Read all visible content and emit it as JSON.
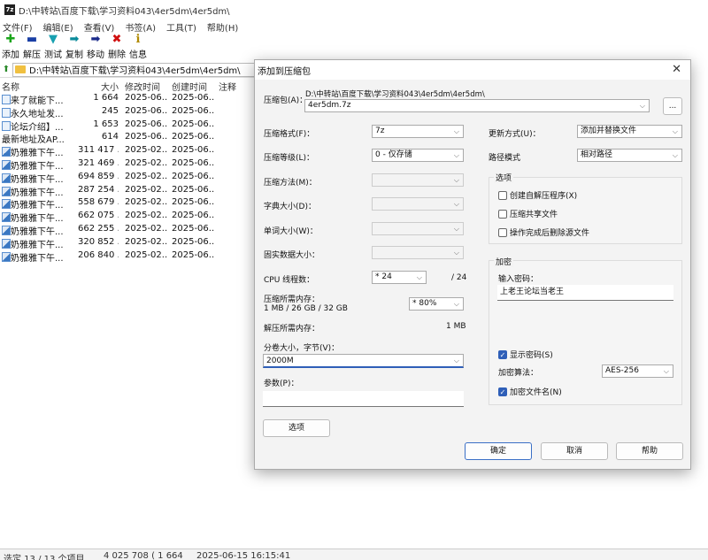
{
  "window": {
    "title": "D:\\中转站\\百度下载\\学习资料043\\4er5dm\\4er5dm\\",
    "icon": "7z"
  },
  "menu": [
    "文件(F)",
    "编辑(E)",
    "查看(V)",
    "书签(A)",
    "工具(T)",
    "帮助(H)"
  ],
  "toolbar": [
    {
      "label": "添加",
      "icon": "plus-icon",
      "glyph": "✚",
      "color": "#1aa51a"
    },
    {
      "label": "解压",
      "icon": "minus-icon",
      "glyph": "▬",
      "color": "#1a3fa5"
    },
    {
      "label": "测试",
      "icon": "check-icon",
      "glyph": "▼",
      "color": "#18a0b0"
    },
    {
      "label": "复制",
      "icon": "copy-arrow-icon",
      "glyph": "➡",
      "color": "#0a8a9a"
    },
    {
      "label": "移动",
      "icon": "move-arrow-icon",
      "glyph": "➡",
      "color": "#1a2a8a"
    },
    {
      "label": "删除",
      "icon": "delete-icon",
      "glyph": "✖",
      "color": "#d01010"
    },
    {
      "label": "信息",
      "icon": "info-icon",
      "glyph": "ℹ",
      "color": "#b08a00"
    }
  ],
  "address": "D:\\中转站\\百度下载\\学习资料043\\4er5dm\\4er5dm\\",
  "columns": {
    "name": "名称",
    "size": "大小",
    "modified": "修改时间",
    "created": "创建时间",
    "comment": "注释"
  },
  "files": [
    {
      "name": "【来了就能下...",
      "size": "1 664",
      "modified": "2025-06...",
      "created": "2025-06...",
      "type": "txt"
    },
    {
      "name": "【永久地址发...",
      "size": "245",
      "modified": "2025-06...",
      "created": "2025-06...",
      "type": "txt"
    },
    {
      "name": "【论坛介绍】...",
      "size": "1 653",
      "modified": "2025-06...",
      "created": "2025-06...",
      "type": "txt"
    },
    {
      "name": "最新地址及AP...",
      "size": "614",
      "modified": "2025-06...",
      "created": "2025-06...",
      "type": "none"
    },
    {
      "name": "骚奶雅雅下午...",
      "size": "311 417 ...",
      "modified": "2025-02...",
      "created": "2025-06...",
      "type": "vid"
    },
    {
      "name": "骚奶雅雅下午...",
      "size": "321 469 ...",
      "modified": "2025-02...",
      "created": "2025-06...",
      "type": "vid"
    },
    {
      "name": "骚奶雅雅下午...",
      "size": "694 859 ...",
      "modified": "2025-02...",
      "created": "2025-06...",
      "type": "vid"
    },
    {
      "name": "骚奶雅雅下午...",
      "size": "287 254 ...",
      "modified": "2025-02...",
      "created": "2025-06...",
      "type": "vid"
    },
    {
      "name": "骚奶雅雅下午...",
      "size": "558 679 ...",
      "modified": "2025-02...",
      "created": "2025-06...",
      "type": "vid"
    },
    {
      "name": "骚奶雅雅下午...",
      "size": "662 075 ...",
      "modified": "2025-02...",
      "created": "2025-06...",
      "type": "vid"
    },
    {
      "name": "骚奶雅雅下午...",
      "size": "662 255 ...",
      "modified": "2025-02...",
      "created": "2025-06...",
      "type": "vid"
    },
    {
      "name": "骚奶雅雅下午...",
      "size": "320 852 ...",
      "modified": "2025-02...",
      "created": "2025-06...",
      "type": "vid"
    },
    {
      "name": "骚奶雅雅下午...",
      "size": "206 840 ...",
      "modified": "2025-02...",
      "created": "2025-06...",
      "type": "vid"
    }
  ],
  "status": {
    "selection": "选定 13 / 13 个项目",
    "size": "4 025 708 ( 1 664",
    "date": "2025-06-15 16:15:41"
  },
  "dialog": {
    "title": "添加到压缩包",
    "archive_label": "压缩包(A)：",
    "archive_path": "D:\\中转站\\百度下载\\学习资料043\\4er5dm\\4er5dm\\",
    "archive_name": "4er5dm.7z",
    "browse_label": "...",
    "format_label": "压缩格式(F)：",
    "format_value": "7z",
    "level_label": "压缩等级(L)：",
    "level_value": "0 - 仅存储",
    "method_label": "压缩方法(M)：",
    "dict_label": "字典大小(D)：",
    "word_label": "单词大小(W)：",
    "solid_label": "固实数据大小：",
    "cpu_label": "CPU 线程数：",
    "cpu_value": "* 24",
    "cpu_max": "/ 24",
    "mem_label": "压缩所需内存：",
    "mem_sub": "1 MB / 26 GB / 32 GB",
    "mem_value": "* 80%",
    "decomp_label": "解压所需内存：",
    "decomp_value": "1 MB",
    "split_label": "分卷大小，字节(V)：",
    "split_value": "2000M",
    "params_label": "参数(P)：",
    "options_button": "选项",
    "update_label": "更新方式(U)：",
    "update_value": "添加并替换文件",
    "pathmode_label": "路径模式",
    "pathmode_value": "相对路径",
    "options_group": "选项",
    "opt_sfx": "创建自解压程序(X)",
    "opt_shared": "压缩共享文件",
    "opt_delete": "操作完成后删除源文件",
    "encrypt_group": "加密",
    "password_label": "输入密码：",
    "password_value": "上老王论坛当老王",
    "show_password": "显示密码(S)",
    "enc_method_label": "加密算法：",
    "enc_method_value": "AES-256",
    "encrypt_names": "加密文件名(N)",
    "ok": "确定",
    "cancel": "取消",
    "help": "帮助"
  }
}
